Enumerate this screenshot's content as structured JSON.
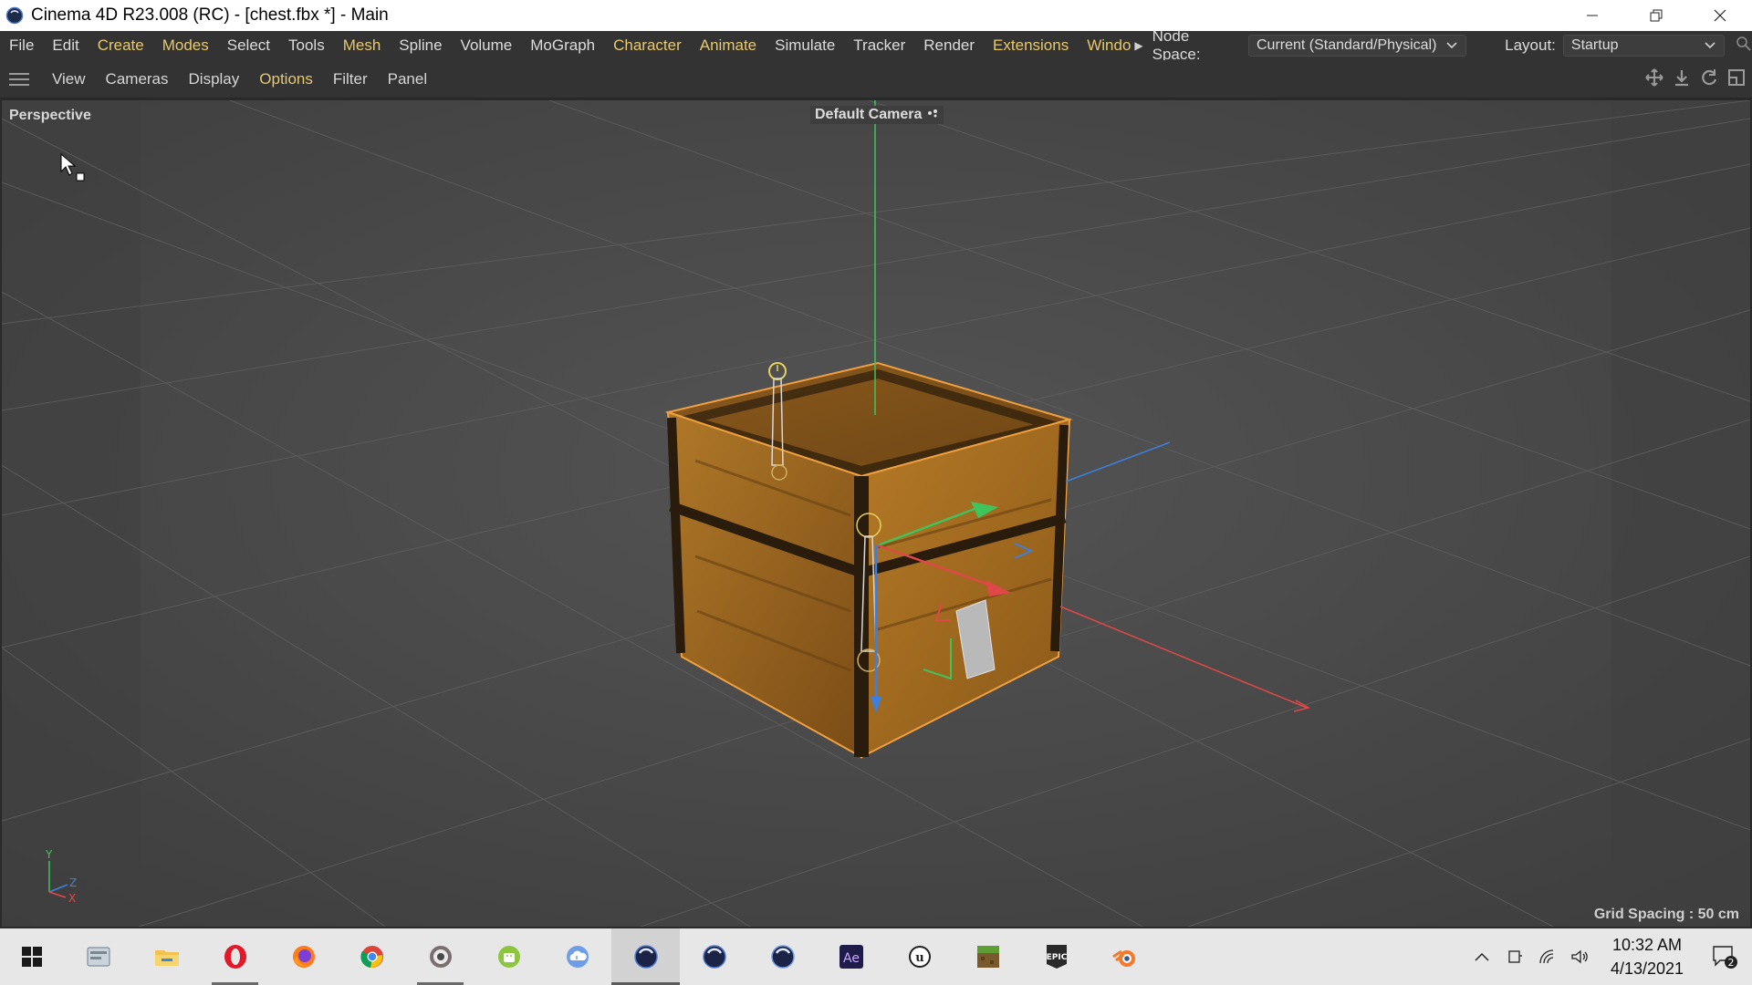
{
  "window": {
    "title": "Cinema 4D R23.008 (RC) - [chest.fbx *] - Main",
    "app_icon": "cinema4d-icon",
    "controls": [
      "minimize-icon",
      "restore-icon",
      "close-icon"
    ]
  },
  "menubar": {
    "items": [
      {
        "label": "File",
        "highlight": false
      },
      {
        "label": "Edit",
        "highlight": false
      },
      {
        "label": "Create",
        "highlight": true
      },
      {
        "label": "Modes",
        "highlight": true
      },
      {
        "label": "Select",
        "highlight": false
      },
      {
        "label": "Tools",
        "highlight": false
      },
      {
        "label": "Mesh",
        "highlight": true
      },
      {
        "label": "Spline",
        "highlight": false
      },
      {
        "label": "Volume",
        "highlight": false
      },
      {
        "label": "MoGraph",
        "highlight": false
      },
      {
        "label": "Character",
        "highlight": true
      },
      {
        "label": "Animate",
        "highlight": true
      },
      {
        "label": "Simulate",
        "highlight": false
      },
      {
        "label": "Tracker",
        "highlight": false
      },
      {
        "label": "Render",
        "highlight": false
      },
      {
        "label": "Extensions",
        "highlight": true
      },
      {
        "label": "Windo",
        "highlight": true
      }
    ],
    "node_space_label": "Node Space:",
    "node_space_value": "Current (Standard/Physical)",
    "layout_label": "Layout:",
    "layout_value": "Startup"
  },
  "viewport_toolbar": {
    "items": [
      {
        "label": "View",
        "highlight": false
      },
      {
        "label": "Cameras",
        "highlight": false
      },
      {
        "label": "Display",
        "highlight": false
      },
      {
        "label": "Options",
        "highlight": true
      },
      {
        "label": "Filter",
        "highlight": false
      },
      {
        "label": "Panel",
        "highlight": false
      }
    ],
    "nav_icons": [
      "move-view-icon",
      "zoom-view-icon",
      "rotate-view-icon",
      "toggle-panel-icon"
    ]
  },
  "viewport": {
    "projection": "Perspective",
    "camera": "Default Camera",
    "grid_spacing": "Grid Spacing : 50 cm",
    "axis_labels": {
      "y": "Y",
      "z": "Z",
      "x": "X"
    },
    "colors": {
      "x_axis": "#e04848",
      "y_axis": "#3ec45a",
      "z_axis": "#3d7fe0",
      "selection": "#f0a040",
      "wood": "#a56b22"
    }
  },
  "taskbar": {
    "apps": [
      {
        "name": "file-explorer-alt-icon",
        "active": false,
        "running": false
      },
      {
        "name": "file-explorer-icon",
        "active": false,
        "running": false
      },
      {
        "name": "opera-icon",
        "active": false,
        "running": true
      },
      {
        "name": "firefox-icon",
        "active": false,
        "running": false
      },
      {
        "name": "chrome-icon",
        "active": false,
        "running": false
      },
      {
        "name": "obs-icon",
        "active": false,
        "running": true
      },
      {
        "name": "android-app-icon",
        "active": false,
        "running": false
      },
      {
        "name": "cloud-music-icon",
        "active": false,
        "running": false
      },
      {
        "name": "cinema4d-icon",
        "active": true,
        "running": true
      },
      {
        "name": "cinema4d-alt-icon",
        "active": false,
        "running": false
      },
      {
        "name": "cinema4d-lite-icon",
        "active": false,
        "running": false
      },
      {
        "name": "after-effects-icon",
        "active": false,
        "running": false
      },
      {
        "name": "unreal-engine-icon",
        "active": false,
        "running": false
      },
      {
        "name": "minecraft-icon",
        "active": false,
        "running": false
      },
      {
        "name": "epic-games-icon",
        "active": false,
        "running": false
      },
      {
        "name": "blender-icon",
        "active": false,
        "running": false
      }
    ],
    "ae_label": "Ae",
    "epic_label": "EPIC",
    "clock_time": "10:32 AM",
    "clock_date": "4/13/2021",
    "notification_count": "2"
  }
}
